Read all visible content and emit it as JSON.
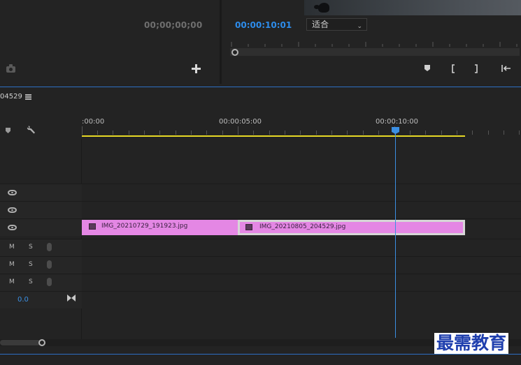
{
  "source_monitor": {
    "timecode": "00;00;00;00"
  },
  "program_monitor": {
    "timecode": "00:00:10:01",
    "fit_selected": "适合"
  },
  "timeline": {
    "sequence_name": "04529",
    "ruler_labels": [
      ":00:00",
      "00:00:05:00",
      "00:00:10:00"
    ],
    "audio_tracks": [
      {
        "mute": "M",
        "solo": "S"
      },
      {
        "mute": "M",
        "solo": "S"
      },
      {
        "mute": "M",
        "solo": "S"
      }
    ],
    "master_volume": "0.0",
    "clips": [
      {
        "name": "IMG_20210729_191923.jpg",
        "color": "#e487e4"
      },
      {
        "name": "IMG_20210805_204529.jpg",
        "color": "#e487e4"
      }
    ],
    "colors": {
      "playhead": "#3b8fe3",
      "work_area": "#e6d825",
      "clip": "#e487e4"
    }
  },
  "watermark": "最需教育"
}
